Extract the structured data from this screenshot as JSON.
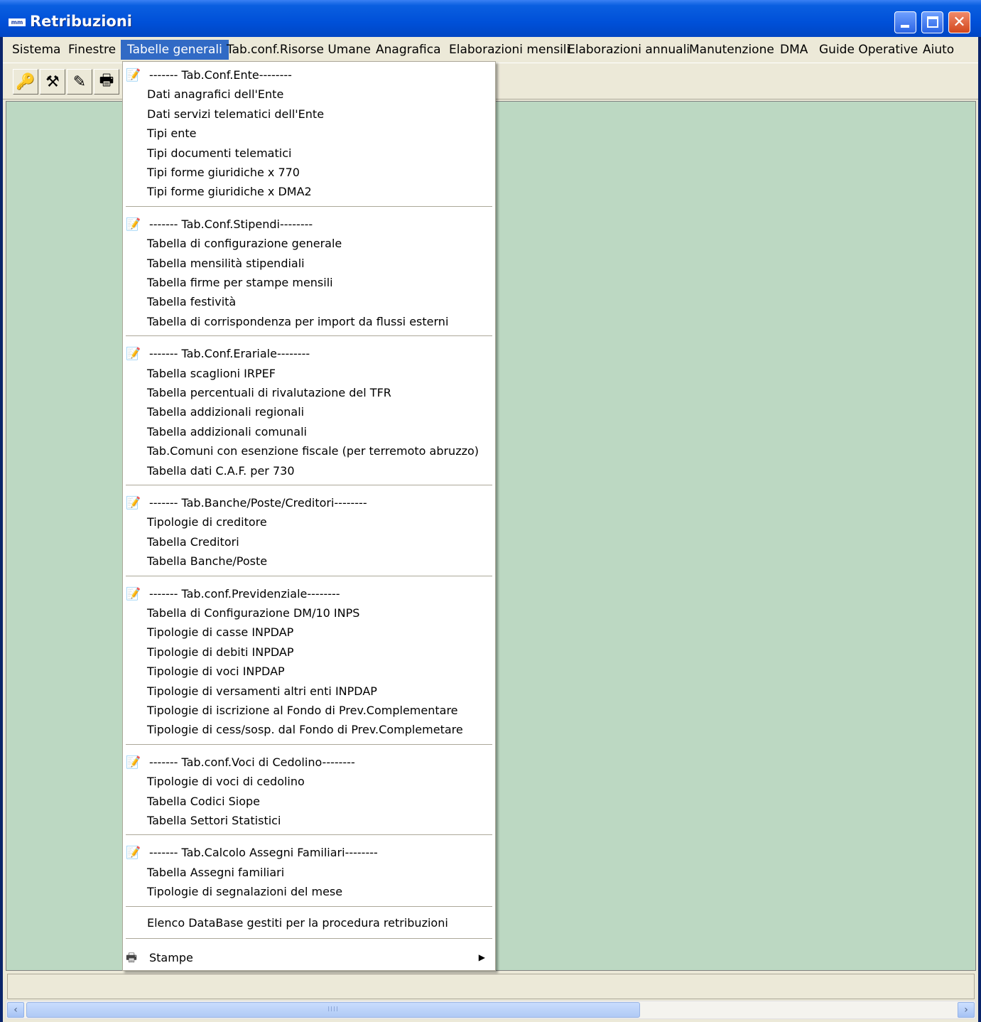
{
  "window": {
    "title": "Retribuzioni",
    "app_icon_text": "mm"
  },
  "titlebar_buttons": {
    "minimize": "minimize",
    "maximize": "maximize",
    "close": "✕"
  },
  "menubar": {
    "items": [
      {
        "label": "Sistema"
      },
      {
        "label": "Finestre"
      },
      {
        "label": "Tabelle generali",
        "active": true
      },
      {
        "label": "Tab.conf.Risorse Umane"
      },
      {
        "label": "Anagrafica"
      },
      {
        "label": "Elaborazioni mensili"
      },
      {
        "label": "Elaborazioni annuali"
      },
      {
        "label": "Manutenzione"
      },
      {
        "label": "DMA"
      },
      {
        "label": "Guide Operative"
      },
      {
        "label": "Aiuto"
      }
    ]
  },
  "toolbar": {
    "icons": [
      "key-icon",
      "tools-icon",
      "edit-pen-icon",
      "printer-icon"
    ],
    "glyphs": [
      "🔑",
      "⚒",
      "✎",
      "🖶"
    ]
  },
  "dropdown": {
    "sections": [
      {
        "header": "------- Tab.Conf.Ente--------",
        "items": [
          "Dati anagrafici dell'Ente",
          "Dati servizi telematici dell'Ente",
          "Tipi ente",
          "Tipi documenti telematici",
          "Tipi forme giuridiche x 770",
          "Tipi forme giuridiche x DMA2"
        ]
      },
      {
        "header": "------- Tab.Conf.Stipendi--------",
        "items": [
          "Tabella di configurazione generale",
          "Tabella mensilità stipendiali",
          "Tabella firme per stampe mensili",
          "Tabella festività",
          "Tabella di corrispondenza per import da flussi esterni"
        ]
      },
      {
        "header": "------- Tab.Conf.Erariale--------",
        "items": [
          "Tabella scaglioni IRPEF",
          "Tabella percentuali di rivalutazione del TFR",
          "Tabella addizionali regionali",
          "Tabella addizionali comunali",
          "Tab.Comuni con esenzione fiscale (per terremoto abruzzo)",
          "Tabella dati C.A.F. per 730"
        ]
      },
      {
        "header": "------- Tab.Banche/Poste/Creditori--------",
        "items": [
          "Tipologie di creditore",
          "Tabella Creditori",
          "Tabella Banche/Poste"
        ]
      },
      {
        "header": "------- Tab.conf.Previdenziale--------",
        "items": [
          "Tabella di Configurazione DM/10 INPS",
          "Tipologie di casse INPDAP",
          "Tipologie di debiti INPDAP",
          "Tipologie di voci INPDAP",
          "Tipologie di versamenti altri enti INPDAP",
          "Tipologie di iscrizione al Fondo di Prev.Complementare",
          "Tipologie di cess/sosp. dal Fondo di Prev.Complemetare"
        ]
      },
      {
        "header": "------- Tab.conf.Voci di Cedolino--------",
        "items": [
          "Tipologie di voci di cedolino",
          "Tabella Codici Siope",
          "Tabella Settori Statistici"
        ]
      },
      {
        "header": "------- Tab.Calcolo Assegni Familiari--------",
        "items": [
          "Tabella Assegni familiari",
          "Tipologie di segnalazioni del mese"
        ]
      }
    ],
    "footer_item": "Elenco DataBase gestiti per la procedura retribuzioni",
    "submenu": {
      "label": "Stampe",
      "icon": "printer-icon",
      "arrow": "▶"
    },
    "header_icon_glyph": "📝",
    "printer_glyph": "🖶"
  },
  "scrollbar": {
    "left_arrow": "‹",
    "right_arrow": "›",
    "thumb_grip": "IIII"
  },
  "colors": {
    "titlebar": "#0050d8",
    "menu_highlight": "#316ac5",
    "client_background": "#bcd8c2",
    "chrome": "#ece9d8"
  }
}
